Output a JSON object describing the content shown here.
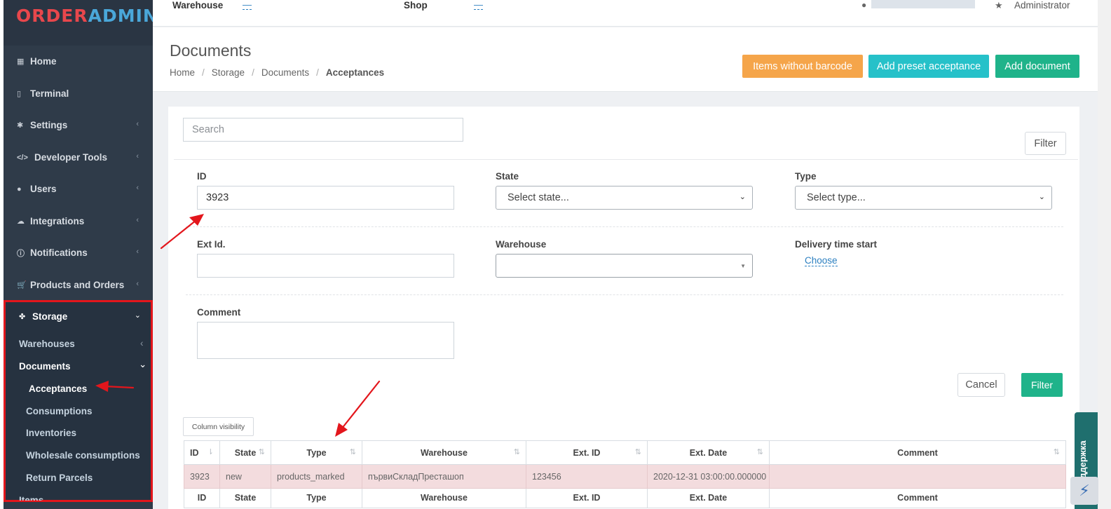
{
  "logo": {
    "part1": "ORDER",
    "part2": "ADMIN"
  },
  "sidebar": {
    "items": [
      {
        "label": "Home",
        "icon": "grid-icon"
      },
      {
        "label": "Terminal",
        "icon": "tablet-icon"
      },
      {
        "label": "Settings",
        "icon": "gear-icon"
      },
      {
        "label": "Developer Tools",
        "icon": "code-icon"
      },
      {
        "label": "Users",
        "icon": "user-icon"
      },
      {
        "label": "Integrations",
        "icon": "cloud-upload-icon"
      },
      {
        "label": "Notifications",
        "icon": "info-icon"
      },
      {
        "label": "Products and Orders",
        "icon": "cart-icon"
      }
    ],
    "storage": {
      "label": "Storage",
      "icon": "cubes-icon",
      "children": {
        "warehouses": "Warehouses",
        "documents": "Documents",
        "documents_children": [
          "Acceptances",
          "Consumptions",
          "Inventories",
          "Wholesale consumptions",
          "Return Parcels"
        ]
      }
    },
    "partial_next": "Items"
  },
  "topbar": {
    "warehouse_label": "Warehouse",
    "warehouse_value": "—",
    "shop_label": "Shop",
    "shop_value": "—",
    "role": "Administrator"
  },
  "header": {
    "title": "Documents",
    "breadcrumb": [
      "Home",
      "Storage",
      "Documents",
      "Acceptances"
    ],
    "buttons": {
      "items_without_barcode": "Items without barcode",
      "add_preset_acceptance": "Add preset acceptance",
      "add_document": "Add document"
    },
    "colors": {
      "orange": "#f5a54a",
      "cyan": "#26c1c9",
      "green": "#1fb38a"
    }
  },
  "filters": {
    "search_placeholder": "Search",
    "filter_toggle": "Filter",
    "id_label": "ID",
    "id_value": "3923",
    "state_label": "State",
    "state_placeholder": "Select state...",
    "type_label": "Type",
    "type_placeholder": "Select type...",
    "ext_id_label": "Ext Id.",
    "warehouse_label": "Warehouse",
    "delivery_label": "Delivery time start",
    "delivery_choose": "Choose",
    "comment_label": "Comment",
    "cancel": "Cancel",
    "apply": "Filter"
  },
  "table": {
    "column_visibility": "Column visibility",
    "headers": [
      "ID",
      "State",
      "Type",
      "Warehouse",
      "Ext. ID",
      "Ext. Date",
      "Comment"
    ],
    "rows": [
      [
        "3923",
        "new",
        "products_marked",
        "първиСкладПресташоп",
        "123456",
        "2020-12-31 03:00:00.000000",
        ""
      ]
    ]
  },
  "support": {
    "label": "Поддержка"
  }
}
